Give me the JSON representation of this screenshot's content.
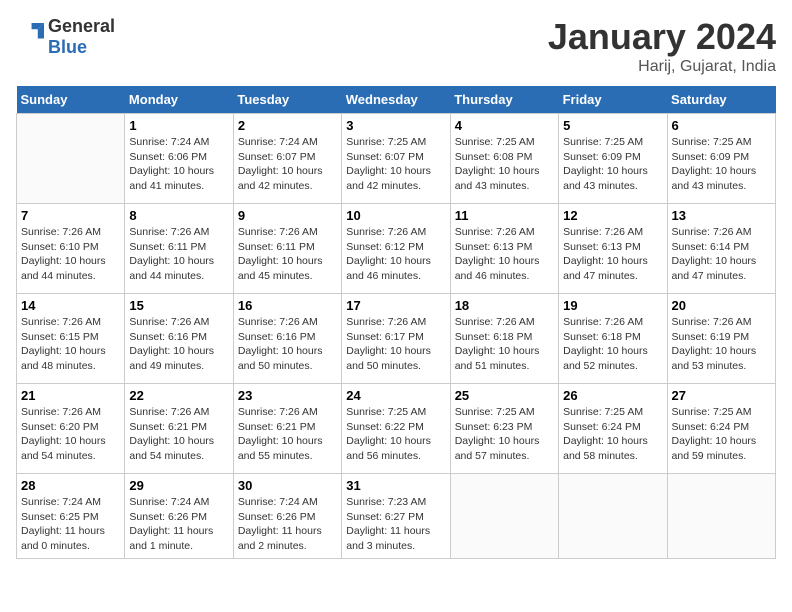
{
  "logo": {
    "general": "General",
    "blue": "Blue"
  },
  "title": "January 2024",
  "subtitle": "Harij, Gujarat, India",
  "weekdays": [
    "Sunday",
    "Monday",
    "Tuesday",
    "Wednesday",
    "Thursday",
    "Friday",
    "Saturday"
  ],
  "weeks": [
    [
      {
        "day": "",
        "info": ""
      },
      {
        "day": "1",
        "info": "Sunrise: 7:24 AM\nSunset: 6:06 PM\nDaylight: 10 hours and 41 minutes."
      },
      {
        "day": "2",
        "info": "Sunrise: 7:24 AM\nSunset: 6:07 PM\nDaylight: 10 hours and 42 minutes."
      },
      {
        "day": "3",
        "info": "Sunrise: 7:25 AM\nSunset: 6:07 PM\nDaylight: 10 hours and 42 minutes."
      },
      {
        "day": "4",
        "info": "Sunrise: 7:25 AM\nSunset: 6:08 PM\nDaylight: 10 hours and 43 minutes."
      },
      {
        "day": "5",
        "info": "Sunrise: 7:25 AM\nSunset: 6:09 PM\nDaylight: 10 hours and 43 minutes."
      },
      {
        "day": "6",
        "info": "Sunrise: 7:25 AM\nSunset: 6:09 PM\nDaylight: 10 hours and 43 minutes."
      }
    ],
    [
      {
        "day": "7",
        "info": "Sunrise: 7:26 AM\nSunset: 6:10 PM\nDaylight: 10 hours and 44 minutes."
      },
      {
        "day": "8",
        "info": "Sunrise: 7:26 AM\nSunset: 6:11 PM\nDaylight: 10 hours and 44 minutes."
      },
      {
        "day": "9",
        "info": "Sunrise: 7:26 AM\nSunset: 6:11 PM\nDaylight: 10 hours and 45 minutes."
      },
      {
        "day": "10",
        "info": "Sunrise: 7:26 AM\nSunset: 6:12 PM\nDaylight: 10 hours and 46 minutes."
      },
      {
        "day": "11",
        "info": "Sunrise: 7:26 AM\nSunset: 6:13 PM\nDaylight: 10 hours and 46 minutes."
      },
      {
        "day": "12",
        "info": "Sunrise: 7:26 AM\nSunset: 6:13 PM\nDaylight: 10 hours and 47 minutes."
      },
      {
        "day": "13",
        "info": "Sunrise: 7:26 AM\nSunset: 6:14 PM\nDaylight: 10 hours and 47 minutes."
      }
    ],
    [
      {
        "day": "14",
        "info": "Sunrise: 7:26 AM\nSunset: 6:15 PM\nDaylight: 10 hours and 48 minutes."
      },
      {
        "day": "15",
        "info": "Sunrise: 7:26 AM\nSunset: 6:16 PM\nDaylight: 10 hours and 49 minutes."
      },
      {
        "day": "16",
        "info": "Sunrise: 7:26 AM\nSunset: 6:16 PM\nDaylight: 10 hours and 50 minutes."
      },
      {
        "day": "17",
        "info": "Sunrise: 7:26 AM\nSunset: 6:17 PM\nDaylight: 10 hours and 50 minutes."
      },
      {
        "day": "18",
        "info": "Sunrise: 7:26 AM\nSunset: 6:18 PM\nDaylight: 10 hours and 51 minutes."
      },
      {
        "day": "19",
        "info": "Sunrise: 7:26 AM\nSunset: 6:18 PM\nDaylight: 10 hours and 52 minutes."
      },
      {
        "day": "20",
        "info": "Sunrise: 7:26 AM\nSunset: 6:19 PM\nDaylight: 10 hours and 53 minutes."
      }
    ],
    [
      {
        "day": "21",
        "info": "Sunrise: 7:26 AM\nSunset: 6:20 PM\nDaylight: 10 hours and 54 minutes."
      },
      {
        "day": "22",
        "info": "Sunrise: 7:26 AM\nSunset: 6:21 PM\nDaylight: 10 hours and 54 minutes."
      },
      {
        "day": "23",
        "info": "Sunrise: 7:26 AM\nSunset: 6:21 PM\nDaylight: 10 hours and 55 minutes."
      },
      {
        "day": "24",
        "info": "Sunrise: 7:25 AM\nSunset: 6:22 PM\nDaylight: 10 hours and 56 minutes."
      },
      {
        "day": "25",
        "info": "Sunrise: 7:25 AM\nSunset: 6:23 PM\nDaylight: 10 hours and 57 minutes."
      },
      {
        "day": "26",
        "info": "Sunrise: 7:25 AM\nSunset: 6:24 PM\nDaylight: 10 hours and 58 minutes."
      },
      {
        "day": "27",
        "info": "Sunrise: 7:25 AM\nSunset: 6:24 PM\nDaylight: 10 hours and 59 minutes."
      }
    ],
    [
      {
        "day": "28",
        "info": "Sunrise: 7:24 AM\nSunset: 6:25 PM\nDaylight: 11 hours and 0 minutes."
      },
      {
        "day": "29",
        "info": "Sunrise: 7:24 AM\nSunset: 6:26 PM\nDaylight: 11 hours and 1 minute."
      },
      {
        "day": "30",
        "info": "Sunrise: 7:24 AM\nSunset: 6:26 PM\nDaylight: 11 hours and 2 minutes."
      },
      {
        "day": "31",
        "info": "Sunrise: 7:23 AM\nSunset: 6:27 PM\nDaylight: 11 hours and 3 minutes."
      },
      {
        "day": "",
        "info": ""
      },
      {
        "day": "",
        "info": ""
      },
      {
        "day": "",
        "info": ""
      }
    ]
  ]
}
